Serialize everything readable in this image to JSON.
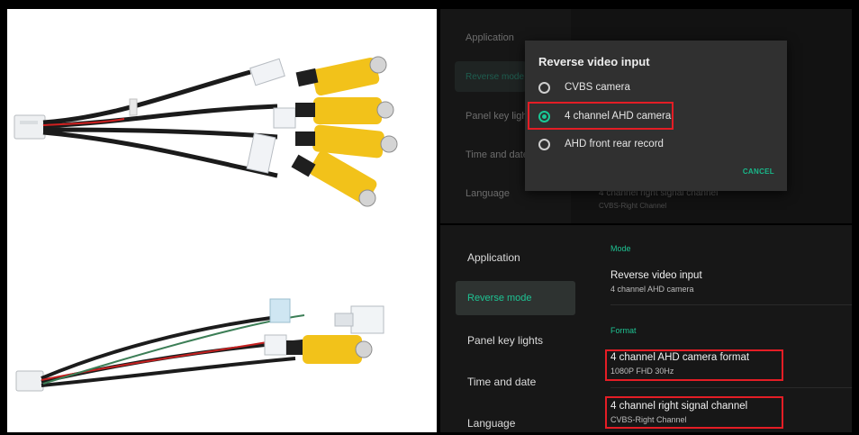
{
  "top_screenshot": {
    "sidebar": {
      "items": [
        {
          "label": "Application"
        },
        {
          "label": "Reverse mode"
        },
        {
          "label": "Panel key lights"
        },
        {
          "label": "Time and date"
        },
        {
          "label": "Language"
        }
      ]
    },
    "background_setting": {
      "title": "4 channel right signal channel",
      "value": "CVBS-Right Channel"
    },
    "dialog": {
      "title": "Reverse video input",
      "options": [
        {
          "label": "CVBS camera",
          "selected": false
        },
        {
          "label": "4 channel AHD camera",
          "selected": true
        },
        {
          "label": "AHD front rear record",
          "selected": false
        }
      ],
      "cancel_label": "CANCEL"
    }
  },
  "bottom_screenshot": {
    "sidebar": {
      "items": [
        {
          "label": "Application"
        },
        {
          "label": "Reverse mode"
        },
        {
          "label": "Panel key lights"
        },
        {
          "label": "Time and date"
        },
        {
          "label": "Language"
        }
      ],
      "active_index": 1
    },
    "mode_section": {
      "header": "Mode",
      "title": "Reverse video input",
      "value": "4 channel AHD camera"
    },
    "format_section": {
      "header": "Format",
      "items": [
        {
          "title": "4 channel AHD camera format",
          "value": "1080P FHD 30Hz"
        },
        {
          "title": "4 channel right signal channel",
          "value": "CVBS-Right Channel"
        }
      ]
    }
  },
  "colors": {
    "accent": "#1ec393",
    "highlight_box": "#e41d25",
    "cable_yellow": "#f2c21a"
  }
}
